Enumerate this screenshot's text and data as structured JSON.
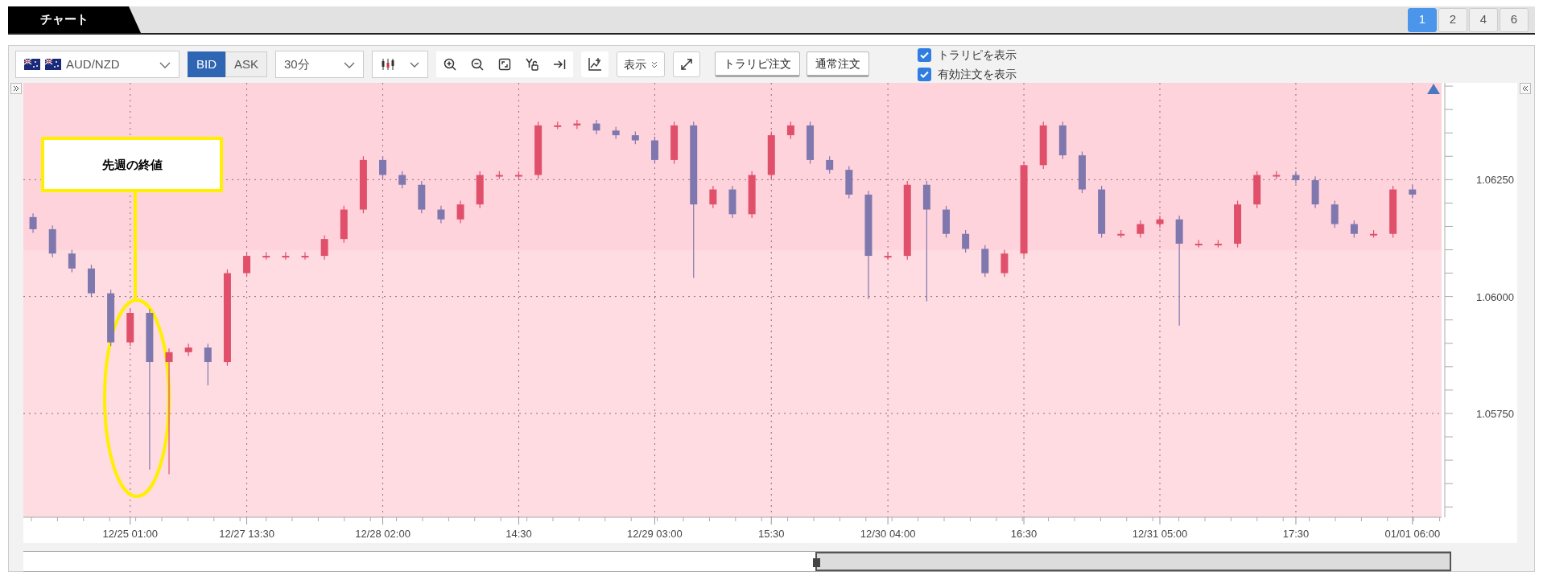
{
  "tab": {
    "label": "チャート"
  },
  "layout_buttons": [
    {
      "label": "1",
      "selected": true
    },
    {
      "label": "2",
      "selected": false
    },
    {
      "label": "4",
      "selected": false
    },
    {
      "label": "6",
      "selected": false
    }
  ],
  "toolbar": {
    "currency_pair": "AUD/NZD",
    "price_types": [
      {
        "label": "BID",
        "selected": true
      },
      {
        "label": "ASK",
        "selected": false
      }
    ],
    "timeframe": "30分",
    "display_menu": "表示",
    "order_buttons": [
      "トラリピ注文",
      "通常注文"
    ],
    "checkboxes": [
      {
        "label": "トラリピを表示",
        "checked": true
      },
      {
        "label": "有効注文を表示",
        "checked": true
      }
    ]
  },
  "chart": {
    "chart_data": {
      "type": "candlestick",
      "grid": true,
      "ylim": [
        1.05528,
        1.06457
      ],
      "categories": [
        null,
        null,
        null,
        null,
        null,
        "12/25 01:00",
        null,
        null,
        null,
        null,
        null,
        "12/27 13:30",
        null,
        null,
        null,
        null,
        null,
        null,
        "12/28 02:00",
        null,
        null,
        null,
        null,
        null,
        null,
        "14:30",
        null,
        null,
        null,
        null,
        null,
        null,
        "12/29 03:00",
        null,
        null,
        null,
        null,
        null,
        "15:30",
        null,
        null,
        null,
        null,
        null,
        "12/30 04:00",
        null,
        null,
        null,
        null,
        null,
        null,
        "16:30",
        null,
        null,
        null,
        null,
        null,
        null,
        "12/31 05:00",
        null,
        null,
        null,
        null,
        null,
        null,
        "17:30",
        null,
        null,
        null,
        null,
        null,
        "01/01 06:00"
      ],
      "ohlc": [
        [
          1.0617,
          1.06178,
          1.06136,
          1.06144
        ],
        [
          1.06144,
          1.06152,
          1.06084,
          1.06092
        ],
        [
          1.06092,
          1.061,
          1.06052,
          1.0606
        ],
        [
          1.0606,
          1.06068,
          1.05999,
          1.06007
        ],
        [
          1.06007,
          1.06015,
          1.05894,
          1.05902
        ],
        [
          1.05902,
          1.05973,
          1.05894,
          1.05965
        ],
        [
          1.05965,
          1.05973,
          1.0563,
          1.0586
        ],
        [
          1.0586,
          1.05889,
          1.0562,
          1.05881
        ],
        [
          1.05881,
          1.05899,
          1.05873,
          1.05891
        ],
        [
          1.05891,
          1.05899,
          1.0581,
          1.0586
        ],
        [
          1.0586,
          1.06058,
          1.05852,
          1.0605
        ],
        [
          1.0605,
          1.06095,
          1.06042,
          1.06087
        ],
        [
          1.06087,
          1.06095,
          1.06079,
          1.06087
        ],
        [
          1.06087,
          1.06095,
          1.06079,
          1.06087
        ],
        [
          1.06087,
          1.06095,
          1.06079,
          1.06087
        ],
        [
          1.06087,
          1.06131,
          1.06079,
          1.06123
        ],
        [
          1.06123,
          1.06194,
          1.06115,
          1.06186
        ],
        [
          1.06186,
          1.063,
          1.06178,
          1.06292
        ],
        [
          1.06292,
          1.063,
          1.06252,
          1.0626
        ],
        [
          1.0626,
          1.06268,
          1.06231,
          1.06239
        ],
        [
          1.06239,
          1.06247,
          1.06178,
          1.06186
        ],
        [
          1.06186,
          1.06194,
          1.06157,
          1.06165
        ],
        [
          1.06165,
          1.06205,
          1.06157,
          1.06197
        ],
        [
          1.06197,
          1.06268,
          1.06189,
          1.0626
        ],
        [
          1.0626,
          1.06268,
          1.06252,
          1.0626
        ],
        [
          1.0626,
          1.06268,
          1.06252,
          1.0626
        ],
        [
          1.0626,
          1.06374,
          1.06252,
          1.06366
        ],
        [
          1.06366,
          1.06374,
          1.06358,
          1.06366
        ],
        [
          1.06366,
          1.06378,
          1.06358,
          1.0637
        ],
        [
          1.0637,
          1.06378,
          1.06347,
          1.06355
        ],
        [
          1.06355,
          1.06363,
          1.06337,
          1.06345
        ],
        [
          1.06345,
          1.06353,
          1.06326,
          1.06334
        ],
        [
          1.06334,
          1.06342,
          1.06284,
          1.06292
        ],
        [
          1.06292,
          1.06374,
          1.06284,
          1.06366
        ],
        [
          1.06366,
          1.06374,
          1.0604,
          1.06197
        ],
        [
          1.06197,
          1.06237,
          1.06189,
          1.06229
        ],
        [
          1.06229,
          1.06237,
          1.06168,
          1.06176
        ],
        [
          1.06176,
          1.06268,
          1.06168,
          1.0626
        ],
        [
          1.0626,
          1.06353,
          1.06252,
          1.06345
        ],
        [
          1.06345,
          1.06374,
          1.06337,
          1.06366
        ],
        [
          1.06366,
          1.06374,
          1.06284,
          1.06292
        ],
        [
          1.06292,
          1.063,
          1.06263,
          1.06271
        ],
        [
          1.06271,
          1.06279,
          1.0621,
          1.06218
        ],
        [
          1.06218,
          1.06226,
          1.05995,
          1.06087
        ],
        [
          1.06087,
          1.06095,
          1.06079,
          1.06087
        ],
        [
          1.06087,
          1.06247,
          1.06079,
          1.06239
        ],
        [
          1.06239,
          1.06247,
          1.0599,
          1.06186
        ],
        [
          1.06186,
          1.06194,
          1.06126,
          1.06134
        ],
        [
          1.06134,
          1.06142,
          1.06094,
          1.06102
        ],
        [
          1.06102,
          1.0611,
          1.06042,
          1.0605
        ],
        [
          1.0605,
          1.061,
          1.06042,
          1.06092
        ],
        [
          1.06092,
          1.06289,
          1.06084,
          1.06281
        ],
        [
          1.06281,
          1.06374,
          1.06273,
          1.06366
        ],
        [
          1.06366,
          1.06374,
          1.06294,
          1.06302
        ],
        [
          1.06302,
          1.0631,
          1.06221,
          1.06229
        ],
        [
          1.06229,
          1.06237,
          1.06126,
          1.06134
        ],
        [
          1.06134,
          1.06142,
          1.06126,
          1.06134
        ],
        [
          1.06134,
          1.06163,
          1.06126,
          1.06155
        ],
        [
          1.06155,
          1.06173,
          1.06147,
          1.06165
        ],
        [
          1.06165,
          1.06173,
          1.05938,
          1.06113
        ],
        [
          1.06113,
          1.06121,
          1.06105,
          1.06113
        ],
        [
          1.06113,
          1.06121,
          1.06105,
          1.06113
        ],
        [
          1.06113,
          1.06205,
          1.06105,
          1.06197
        ],
        [
          1.06197,
          1.06268,
          1.06189,
          1.0626
        ],
        [
          1.0626,
          1.06268,
          1.06252,
          1.0626
        ],
        [
          1.0626,
          1.06268,
          1.06241,
          1.06249
        ],
        [
          1.06249,
          1.06257,
          1.06189,
          1.06197
        ],
        [
          1.06197,
          1.06205,
          1.06147,
          1.06155
        ],
        [
          1.06155,
          1.06163,
          1.06126,
          1.06134
        ],
        [
          1.06134,
          1.06142,
          1.06126,
          1.06134
        ],
        [
          1.06134,
          1.06237,
          1.06126,
          1.06229
        ],
        [
          1.06229,
          1.06237,
          1.0621,
          1.06218
        ]
      ],
      "yticks": [
        {
          "value": 1.0625,
          "label": "1.06250"
        },
        {
          "value": 1.06,
          "label": "1.06000"
        },
        {
          "value": 1.0575,
          "label": "1.05750"
        }
      ],
      "annotations": [
        {
          "text": "先週の終値"
        }
      ]
    }
  }
}
